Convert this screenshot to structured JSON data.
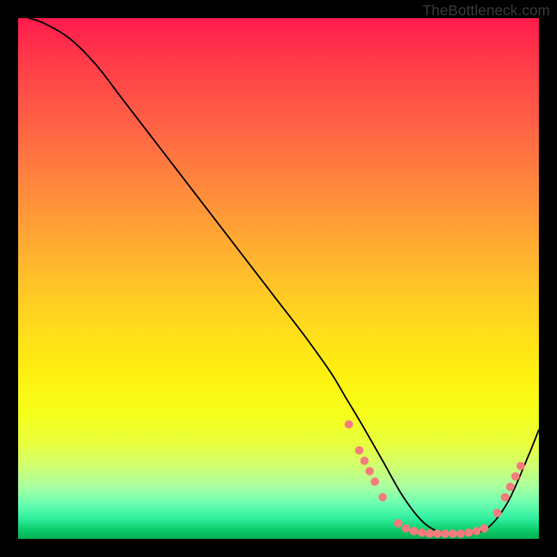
{
  "watermark": "TheBottleneck.com",
  "chart_data": {
    "type": "line",
    "title": "",
    "xlabel": "",
    "ylabel": "",
    "xlim": [
      0,
      100
    ],
    "ylim": [
      0,
      100
    ],
    "grid": false,
    "series": [
      {
        "name": "bottleneck-curve",
        "x": [
          2,
          5,
          10,
          15,
          20,
          25,
          30,
          35,
          40,
          45,
          50,
          55,
          60,
          63,
          66,
          70,
          74,
          78,
          82,
          86,
          90,
          94,
          98,
          100
        ],
        "y": [
          100,
          99,
          96,
          91,
          84.5,
          78,
          71.5,
          65,
          58.5,
          52,
          45.5,
          39,
          32,
          27,
          22,
          15,
          8,
          3,
          1,
          1,
          2,
          7,
          16,
          21
        ]
      }
    ],
    "markers": [
      {
        "x": 63.5,
        "y": 22
      },
      {
        "x": 65.5,
        "y": 17
      },
      {
        "x": 66.5,
        "y": 15
      },
      {
        "x": 67.5,
        "y": 13
      },
      {
        "x": 68.5,
        "y": 11
      },
      {
        "x": 70.0,
        "y": 8
      },
      {
        "x": 73.0,
        "y": 3
      },
      {
        "x": 74.5,
        "y": 2
      },
      {
        "x": 76.0,
        "y": 1.5
      },
      {
        "x": 77.5,
        "y": 1.2
      },
      {
        "x": 79.0,
        "y": 1
      },
      {
        "x": 80.5,
        "y": 1
      },
      {
        "x": 82.0,
        "y": 1
      },
      {
        "x": 83.5,
        "y": 1
      },
      {
        "x": 85.0,
        "y": 1
      },
      {
        "x": 86.5,
        "y": 1.2
      },
      {
        "x": 88.0,
        "y": 1.5
      },
      {
        "x": 89.5,
        "y": 2
      },
      {
        "x": 92.0,
        "y": 5
      },
      {
        "x": 93.5,
        "y": 8
      },
      {
        "x": 94.5,
        "y": 10
      },
      {
        "x": 95.5,
        "y": 12
      },
      {
        "x": 96.5,
        "y": 14
      }
    ],
    "marker_color": "#f47c7c",
    "curve_color": "#000000"
  }
}
